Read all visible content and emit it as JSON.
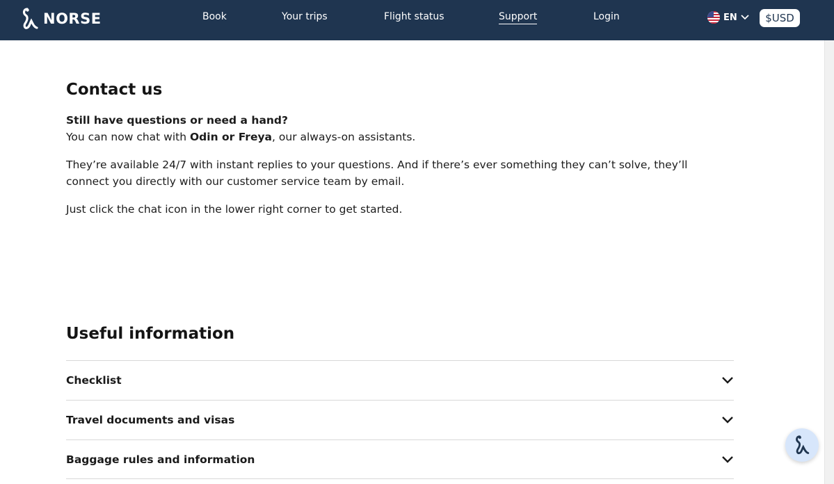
{
  "brand": {
    "name": "NORSE"
  },
  "nav": {
    "links": [
      "Book",
      "Your trips",
      "Flight status",
      "Support",
      "Login"
    ],
    "active": "Support",
    "language": "EN",
    "currency": "$USD"
  },
  "contact": {
    "title": "Contact us",
    "intro_bold": "Still have questions or need a hand?",
    "intro_prefix": "You can now chat with ",
    "assistants": "Odin or Freya",
    "intro_suffix": ", our always-on assistants.",
    "availability": "They’re available 24/7 with instant replies to your questions. And if there’s ever something they can’t solve, they’ll connect you directly with our customer service team by email.",
    "instruction": "Just click the chat icon in the lower right corner to get started."
  },
  "useful": {
    "title": "Useful information",
    "items": [
      "Checklist",
      "Travel documents and visas",
      "Baggage rules and information"
    ]
  },
  "colors": {
    "nav_bg": "#1f3550",
    "chat_bubble": "#d7e6fb"
  },
  "icons": {
    "logo": "norse-logo-icon",
    "flag": "us-flag-icon",
    "chevron": "chevron-down-icon",
    "chat": "chat-icon"
  }
}
